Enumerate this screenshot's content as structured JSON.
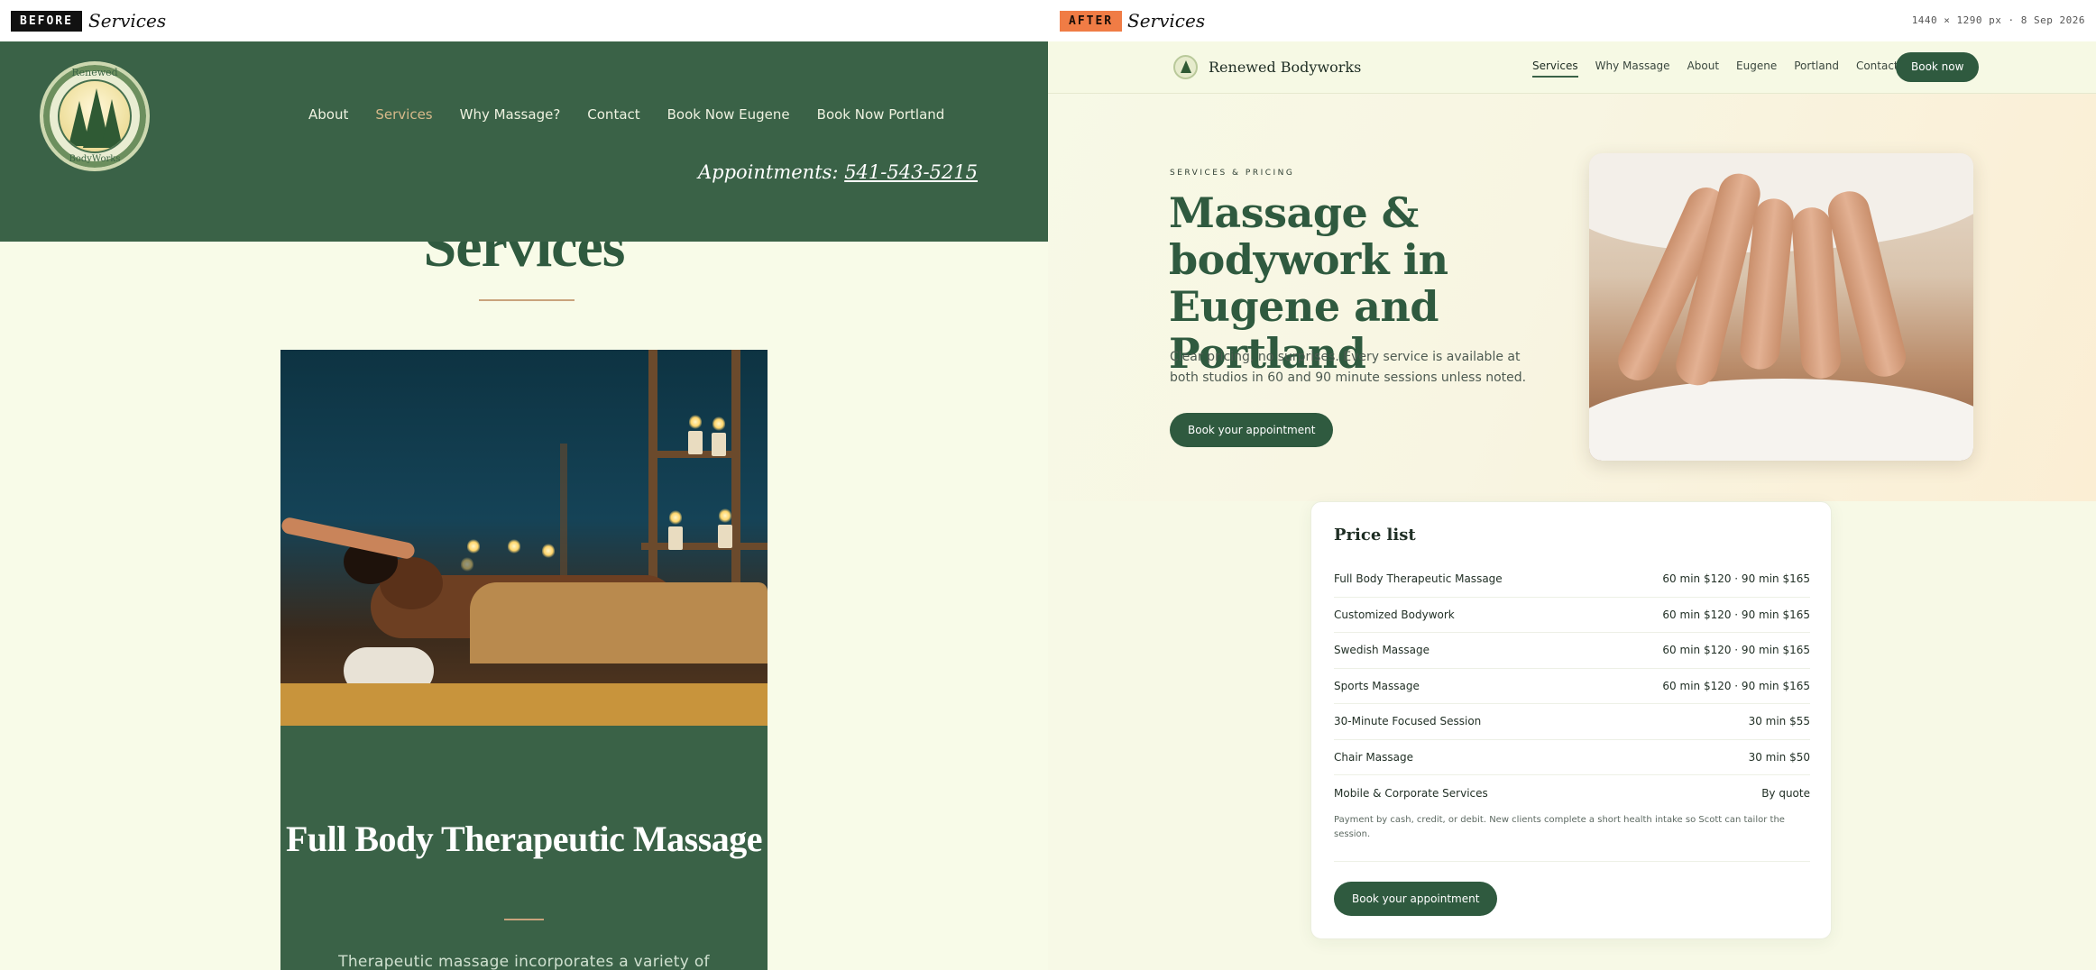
{
  "labels": {
    "before_tag": "BEFORE",
    "before_title": "Services",
    "after_tag": "AFTER",
    "after_title": "Services",
    "meta": "1440 × 1290 px · 8 Sep 2026"
  },
  "before": {
    "logo": {
      "text_top": "Renewed",
      "text_bottom": "BodyWorks"
    },
    "nav": [
      "About",
      "Services",
      "Why Massage?",
      "Contact",
      "Book Now Eugene",
      "Book Now Portland"
    ],
    "nav_active": "Services",
    "appointments_label": "Appointments:",
    "phone": "541-543-5215",
    "page_title": "Services",
    "card_title": "Full Body Therapeutic Massage",
    "card_text": "Therapeutic massage incorporates a variety of"
  },
  "after": {
    "brand": "Renewed Bodyworks",
    "nav": [
      "Services",
      "Why Massage",
      "About",
      "Eugene",
      "Portland",
      "Contact"
    ],
    "nav_active": "Services",
    "book_now": "Book now",
    "eyebrow": "SERVICES & PRICING",
    "heading": "Massage & bodywork in Eugene and Portland",
    "subtext": "Clear pricing, no surprises. Every service is available at both studios in 60 and 90 minute sessions unless noted.",
    "hero_cta": "Book your appointment",
    "price_list": {
      "title": "Price list",
      "rows": [
        {
          "service": "Full Body Therapeutic Massage",
          "price": "60 min $120 · 90 min $165"
        },
        {
          "service": "Customized Bodywork",
          "price": "60 min $120 · 90 min $165"
        },
        {
          "service": "Swedish Massage",
          "price": "60 min $120 · 90 min $165"
        },
        {
          "service": "Sports Massage",
          "price": "60 min $120 · 90 min $165"
        },
        {
          "service": "30-Minute Focused Session",
          "price": "30 min $55"
        },
        {
          "service": "Chair Massage",
          "price": "30 min $50"
        },
        {
          "service": "Mobile & Corporate Services",
          "price": "By quote"
        }
      ],
      "note": "Payment by cash, credit, or debit. New clients complete a short health intake so Scott can tailor the session.",
      "cta": "Book your appointment"
    }
  },
  "colors": {
    "forest_green": "#3a6247",
    "button_green": "#2f5a3f",
    "cream": "#f7f9e6",
    "accent_tan": "#c9a37c",
    "after_tag": "#f07c45"
  }
}
